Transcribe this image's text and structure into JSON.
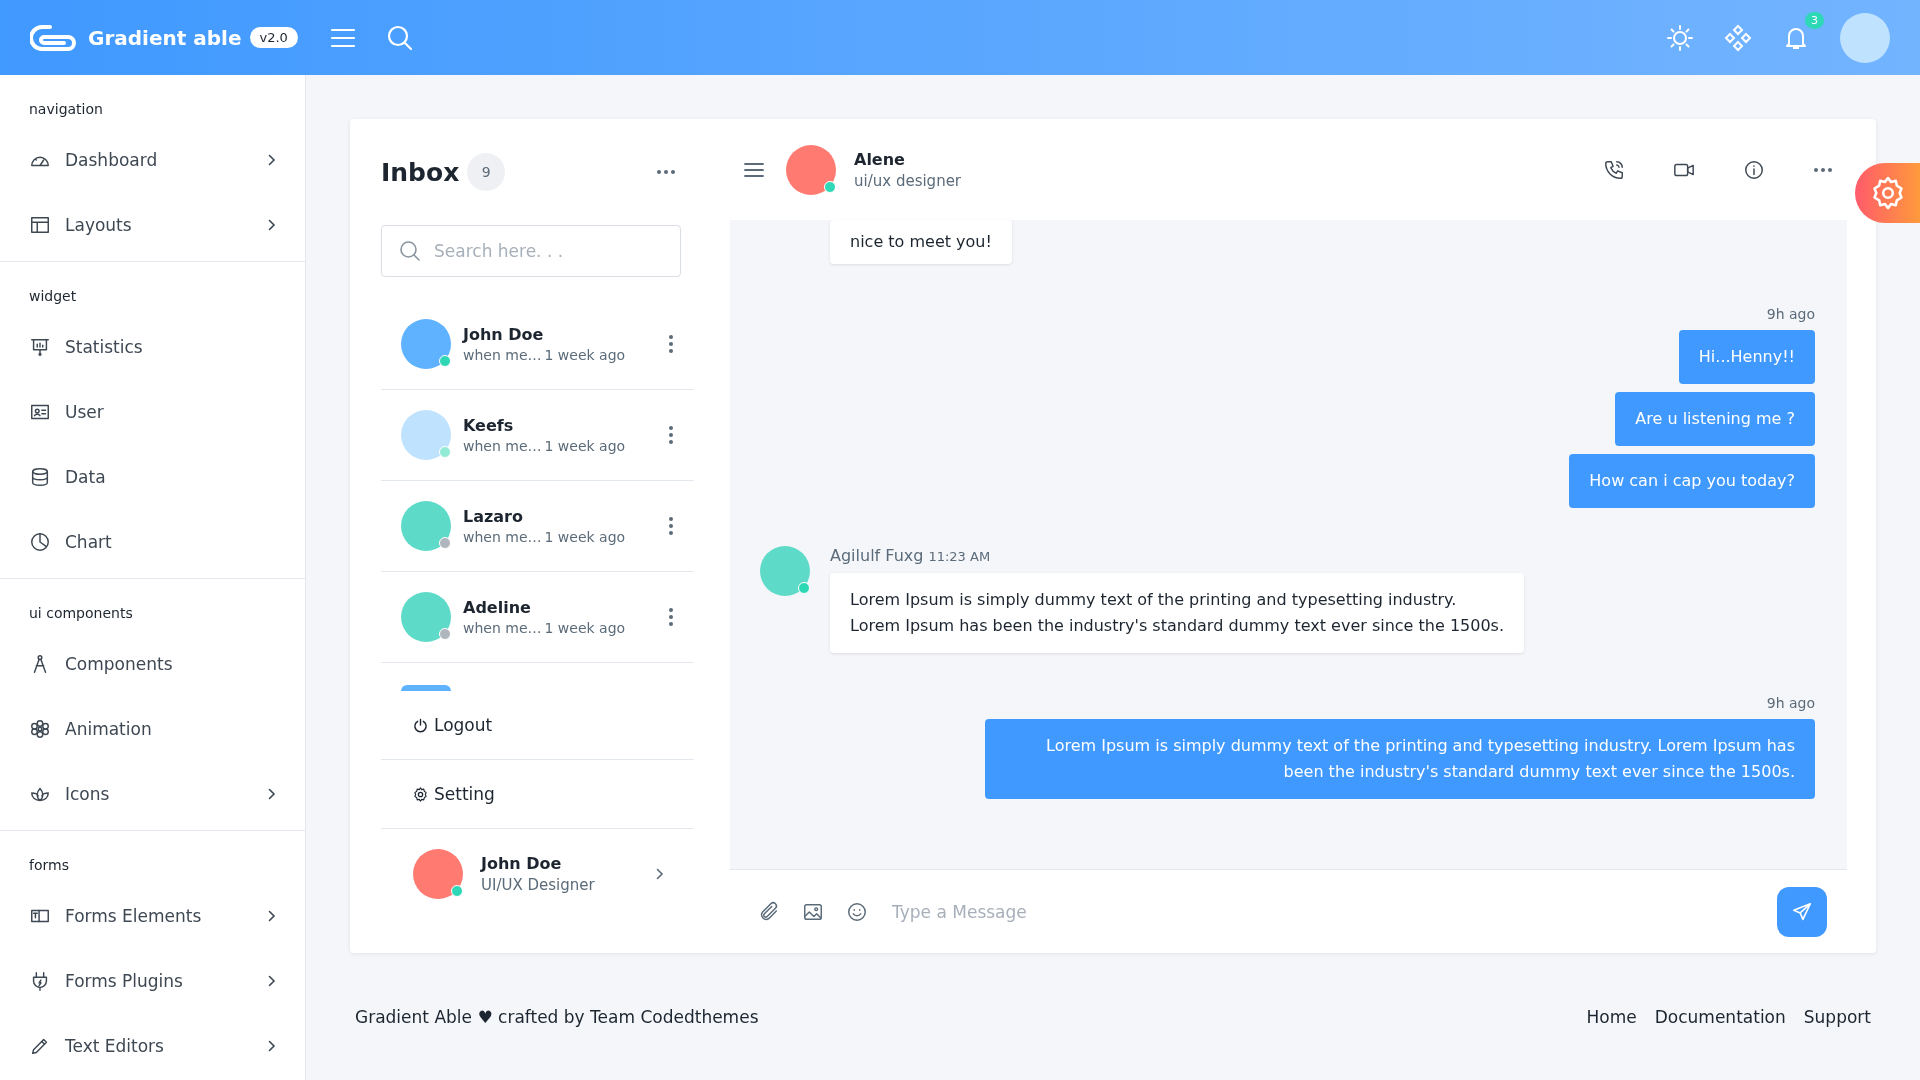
{
  "header": {
    "brand": "Gradient able",
    "version": "v2.0",
    "notifications": "3"
  },
  "sidebar": {
    "sections": [
      {
        "title": "navigation",
        "items": [
          {
            "label": "Dashboard",
            "has_submenu": true
          },
          {
            "label": "Layouts",
            "has_submenu": true
          }
        ]
      },
      {
        "title": "widget",
        "items": [
          {
            "label": "Statistics",
            "has_submenu": false
          },
          {
            "label": "User",
            "has_submenu": false
          },
          {
            "label": "Data",
            "has_submenu": false
          },
          {
            "label": "Chart",
            "has_submenu": false
          }
        ]
      },
      {
        "title": "ui components",
        "items": [
          {
            "label": "Components",
            "has_submenu": false
          },
          {
            "label": "Animation",
            "has_submenu": false
          },
          {
            "label": "Icons",
            "has_submenu": true
          }
        ]
      },
      {
        "title": "forms",
        "items": [
          {
            "label": "Forms Elements",
            "has_submenu": true
          },
          {
            "label": "Forms Plugins",
            "has_submenu": true
          },
          {
            "label": "Text Editors",
            "has_submenu": true
          }
        ]
      }
    ]
  },
  "inbox": {
    "title": "Inbox",
    "count": "9",
    "search": {
      "placeholder": "Search here. . ."
    },
    "contacts": [
      {
        "name": "John Doe",
        "preview": "when me…",
        "time": "1 week ago",
        "color": "#2ed8b6"
      },
      {
        "name": "Keefs",
        "preview": "when me…",
        "time": "1 week ago",
        "color": "#93ead6"
      },
      {
        "name": "Lazaro",
        "preview": "when me…",
        "time": "1 week ago",
        "color": "#b0b6bd"
      },
      {
        "name": "Adeline",
        "preview": "when me…",
        "time": "1 week ago",
        "color": "#b0b6bd"
      }
    ],
    "menu": [
      "Logout",
      "Setting"
    ],
    "profile": {
      "name": "John Doe",
      "role": "UI/UX Designer"
    }
  },
  "chat": {
    "contact": {
      "name": "Alene",
      "role": "ui/ux designer"
    },
    "messages": [
      {
        "kind": "received",
        "text": "nice to meet you!"
      },
      {
        "kind": "time",
        "text": "9h ago"
      },
      {
        "kind": "sent",
        "text": "Hi...Henny!!"
      },
      {
        "kind": "sent",
        "text": "Are u listening me ?"
      },
      {
        "kind": "sent",
        "text": "How can i cap you today?"
      },
      {
        "kind": "received",
        "sender": "Agilulf Fuxg",
        "time": "11:23 AM",
        "text": "Lorem Ipsum is simply dummy text of the printing and typesetting industry.\nLorem Ipsum has been the industry's standard dummy text ever since the 1500s."
      },
      {
        "kind": "time",
        "text": "9h ago"
      },
      {
        "kind": "sent",
        "text": "Lorem Ipsum is simply dummy text of the printing and typesetting industry. Lorem Ipsum has been the industry's standard dummy text ever since the 1500s."
      }
    ],
    "input": {
      "placeholder": "Type a Message"
    }
  },
  "footer": {
    "credit": "Gradient Able ♥ crafted by Team Codedthemes",
    "links": [
      "Home",
      "Documentation",
      "Support"
    ]
  }
}
